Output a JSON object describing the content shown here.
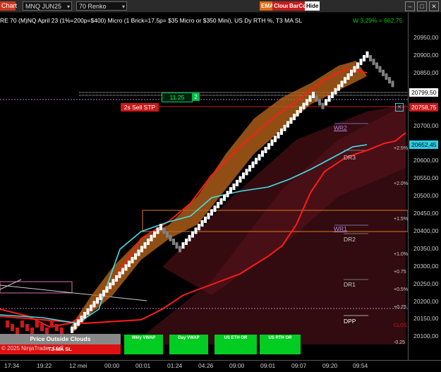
{
  "toolbar": {
    "chart_label": "Chart",
    "instrument": "MNQ JUN25",
    "period": "70 Renko",
    "pill_ema": "EMA",
    "pill_cloud": "Cloud",
    "pill_barcol": "BarCol",
    "hide_label": "Hide",
    "icons": [
      "chevron-down-icon",
      "minimize-icon",
      "maximize-icon",
      "close-icon"
    ]
  },
  "header": {
    "title": "RE 70 (M)NQ April 23 (1%=200p=$400) Micro (1 Brick=17.5p= $35 Micro or $350 Mini), US Dy RTH %, T3 MA SL",
    "pnl": "W 3,29% = 662,75"
  },
  "order_line": {
    "qty": "11.25",
    "count": "2",
    "order_label": "2s  Sell STP"
  },
  "price_boxes": {
    "last": "20799,50",
    "stop": "20758,75",
    "cyan": "20652,45"
  },
  "levels": {
    "wr2": "WR2",
    "dr3": "DR3",
    "wr1": "WR1",
    "dr2": "DR2",
    "dr1": "DR1",
    "dpp": "DPP",
    "clos": "CLOS"
  },
  "pct_labels": [
    "+2.5%",
    "+2.0%",
    "+1.5%",
    "+1.0%",
    "+0.75",
    "+0.5%",
    "+0.25",
    "-0.25"
  ],
  "y_ticks": [
    "20950,00",
    "20900,00",
    "20850,00",
    "20800,00",
    "20750,00",
    "20700,00",
    "20650,00",
    "20600,00",
    "20550,00",
    "20500,00",
    "20450,00",
    "20400,00",
    "20350,00",
    "20300,00",
    "20250,00",
    "20200,00",
    "20150,00",
    "20100,00"
  ],
  "x_ticks": [
    "17:34",
    "19:22",
    "12 mei",
    "00:00",
    "00:01",
    "01:24",
    "04:26",
    "09:00",
    "09:01",
    "09:07",
    "09:20",
    "09:54"
  ],
  "bottom_panel": {
    "outside_clouds": "Price Outside Clouds",
    "t3_ma_sl": "T3 MA SL",
    "copyright": "© 2025 NinjaTrader, LLC",
    "buttons": [
      "Wkly VWAP",
      "Day VWAP",
      "US ETH OR",
      "US RTH OR"
    ]
  },
  "chart_data": {
    "type": "renko",
    "y_range": [
      20090,
      20985
    ],
    "series": [
      {
        "name": "T3 MA SL",
        "values": [
          20190,
          20175,
          20160,
          20185,
          20230,
          20350,
          20430,
          20470,
          20560,
          20640,
          20730,
          20810,
          20860,
          20850
        ]
      },
      {
        "name": "VWAP",
        "values": [
          20170,
          20160,
          20150,
          20170,
          20260,
          20410,
          20440,
          20520,
          20540,
          20550,
          20580,
          20620,
          20650,
          20652
        ]
      }
    ],
    "horizontal_levels": [
      20799.5,
      20758.75,
      20463,
      20404
    ]
  },
  "colors": {
    "bull_brick": "#ffffff",
    "bear_brick": "#808080",
    "cloud": "#b8641a",
    "stop_line": "#ff1a1a",
    "vwap": "#3ee0e8",
    "or_box": "#e07a20",
    "green_btn": "#00cc22"
  }
}
